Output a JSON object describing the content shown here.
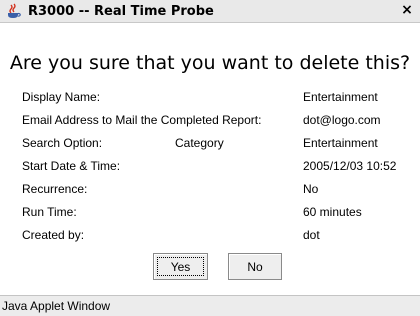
{
  "window": {
    "title": "R3000 -- Real Time Probe",
    "close_glyph": "×",
    "title_icon": "java-cup-icon"
  },
  "dialog": {
    "heading": "Are you sure that you want to delete this?",
    "fields": [
      {
        "label": "Display Name:",
        "middle": "",
        "value": "Entertainment"
      },
      {
        "label": "Email Address to Mail the Completed Report:",
        "middle": "",
        "value": "dot@logo.com"
      },
      {
        "label": "Search Option:",
        "middle": "Category",
        "value": "Entertainment"
      },
      {
        "label": "Start Date & Time:",
        "middle": "",
        "value": "2005/12/03 10:52"
      },
      {
        "label": "Recurrence:",
        "middle": "",
        "value": "No"
      },
      {
        "label": "Run Time:",
        "middle": "",
        "value": "60 minutes"
      },
      {
        "label": "Created by:",
        "middle": "",
        "value": "dot"
      }
    ],
    "buttons": {
      "yes": "Yes",
      "no": "No"
    }
  },
  "status_bar": {
    "text": "Java Applet Window"
  }
}
